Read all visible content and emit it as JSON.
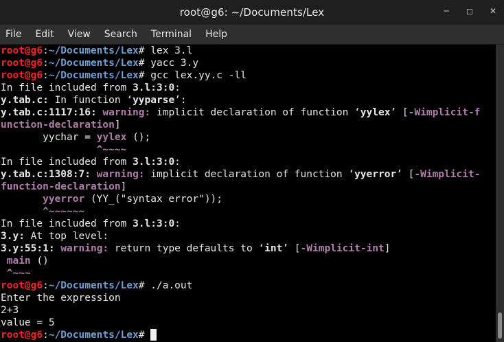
{
  "window": {
    "title": "root@g6: ~/Documents/Lex"
  },
  "menu": [
    "File",
    "Edit",
    "View",
    "Search",
    "Terminal",
    "Help"
  ],
  "colors": {
    "prompt_user": "#ef2929",
    "prompt_path": "#729fcf",
    "warning": "#ad7fa8",
    "cursor": "#f0f0f0"
  },
  "terminal": {
    "prompt_user": "root@g6",
    "prompt_sep": ":",
    "prompt_path": "~/Documents/Lex",
    "prompt_end": "# ",
    "cmd1": "lex 3.l",
    "cmd2": "yacc 3.y",
    "cmd3": "gcc lex.yy.c -ll",
    "l4": "In file included from ",
    "l4b": "3.l:3:0",
    "l4c": ":",
    "l5a": "y.tab.c:",
    "l5b": " In function ‘",
    "l5c": "yyparse",
    "l5d": "’:",
    "l6a": "y.tab.c:1117:16: ",
    "l6b": "warning:",
    "l6c": " implicit declaration of function ‘",
    "l6d": "yylex",
    "l6e": "’ [",
    "l6f": "-Wimplicit-f",
    "l7a": "unction-declaration",
    "l7b": "]",
    "l8a": "       yychar = ",
    "l8b": "yylex",
    "l8c": " ();",
    "l9": "                ^~~~~",
    "l10": "In file included from ",
    "l10b": "3.l:3:0",
    "l10c": ":",
    "l11a": "y.tab.c:1308:7: ",
    "l11b": "warning:",
    "l11c": " implicit declaration of function ‘",
    "l11d": "yyerror",
    "l11e": "’ [",
    "l11f": "-Wimplicit-",
    "l12a": "function-declaration",
    "l12b": "]",
    "l13a": "       ",
    "l13b": "yyerror",
    "l13c": " (YY_(\"syntax error\"));",
    "l14": "       ^~~~~~~",
    "l15": "In file included from ",
    "l15b": "3.l:3:0",
    "l15c": ":",
    "l16a": "3.y:",
    "l16b": " At top level:",
    "l17a": "3.y:55:1: ",
    "l17b": "warning:",
    "l17c": " return type defaults to ‘",
    "l17d": "int",
    "l17e": "’ [",
    "l17f": "-Wimplicit-int",
    "l17g": "]",
    "l18a": " ",
    "l18b": "main",
    "l18c": " ()",
    "l19": " ^~~~",
    "cmd4": "./a.out",
    "out1": "Enter the expression",
    "out2": "2+3",
    "out3": "value = 5"
  }
}
